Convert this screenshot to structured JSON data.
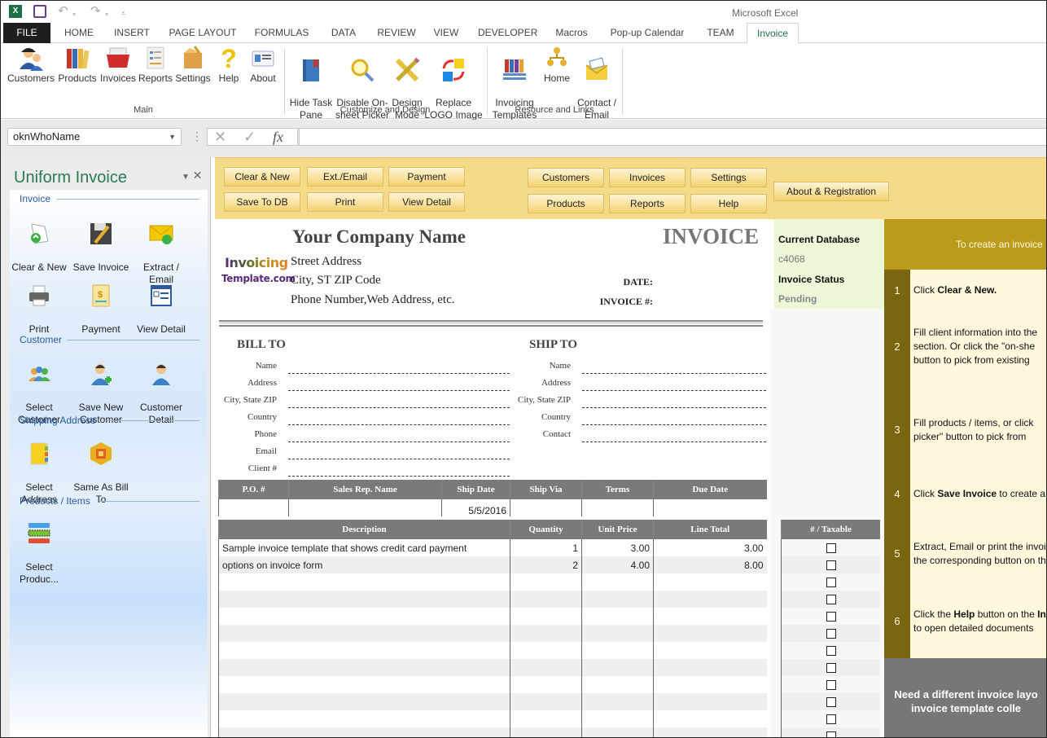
{
  "window": {
    "app_title": "Microsoft Excel",
    "quick_access": [
      "excel-logo-icon",
      "save-icon",
      "undo-icon",
      "redo-icon",
      "customize-qat-icon"
    ]
  },
  "tabs": [
    {
      "label": "FILE",
      "active": false
    },
    {
      "label": "HOME",
      "active": false
    },
    {
      "label": "INSERT",
      "active": false
    },
    {
      "label": "PAGE LAYOUT",
      "active": false
    },
    {
      "label": "FORMULAS",
      "active": false
    },
    {
      "label": "DATA",
      "active": false
    },
    {
      "label": "REVIEW",
      "active": false
    },
    {
      "label": "VIEW",
      "active": false
    },
    {
      "label": "DEVELOPER",
      "active": false
    },
    {
      "label": "Macros",
      "active": false
    },
    {
      "label": "Pop-up Calendar",
      "active": false
    },
    {
      "label": "TEAM",
      "active": false
    },
    {
      "label": "Invoice",
      "active": true
    }
  ],
  "ribbon": {
    "groups": [
      {
        "label": "Main",
        "buttons": [
          {
            "label": "Customers",
            "icon": "customers-icon"
          },
          {
            "label": "Products",
            "icon": "products-icon"
          },
          {
            "label": "Invoices",
            "icon": "invoices-icon"
          },
          {
            "label": "Reports",
            "icon": "reports-icon"
          },
          {
            "label": "Settings",
            "icon": "settings-icon"
          },
          {
            "label": "Help",
            "icon": "help-icon"
          },
          {
            "label": "About",
            "icon": "about-icon"
          }
        ]
      },
      {
        "label": "Customize and Design",
        "buttons": [
          {
            "label": "Hide Task\nPane",
            "icon": "hide-task-pane-icon"
          },
          {
            "label": "Disable On-\nsheet Picker",
            "icon": "disable-picker-icon"
          },
          {
            "label": "Design\nMode",
            "icon": "design-mode-icon"
          },
          {
            "label": "Replace\nLOGO Image",
            "icon": "replace-logo-icon"
          }
        ]
      },
      {
        "label": "Resource and Links",
        "buttons": [
          {
            "label": "Invoicing\nTemplates",
            "icon": "invoicing-templates-icon"
          },
          {
            "label": "Home",
            "icon": "home-icon"
          },
          {
            "label": "Contact /\nEmail",
            "icon": "contact-email-icon"
          }
        ]
      }
    ]
  },
  "formula_bar": {
    "name_box": "oknWhoName",
    "formula": ""
  },
  "task_pane": {
    "title": "Uniform Invoice",
    "sections": [
      {
        "title": "Invoice",
        "buttons": [
          {
            "label": "Clear & New",
            "icon": "clear-new-icon"
          },
          {
            "label": "Save Invoice",
            "icon": "save-invoice-icon"
          },
          {
            "label": "Extract /\nEmail",
            "icon": "extract-email-icon"
          },
          {
            "label": "Print",
            "icon": "print-icon"
          },
          {
            "label": "Payment",
            "icon": "payment-icon"
          },
          {
            "label": "View Detail",
            "icon": "view-detail-icon"
          }
        ]
      },
      {
        "title": "Customer",
        "buttons": [
          {
            "label": "Select\nCustomer",
            "icon": "select-customer-icon"
          },
          {
            "label": "Save New\nCustomer",
            "icon": "save-new-customer-icon"
          },
          {
            "label": "Customer\nDetail",
            "icon": "customer-detail-icon"
          }
        ]
      },
      {
        "title": "Shipping Address",
        "buttons": [
          {
            "label": "Select\nAddress",
            "icon": "select-address-icon"
          },
          {
            "label": "Same As Bill\nTo",
            "icon": "same-as-bill-to-icon"
          }
        ]
      },
      {
        "title": "Products / Items",
        "buttons": [
          {
            "label": "Select\nProduc...",
            "icon": "select-products-icon"
          }
        ]
      }
    ]
  },
  "sheet_buttons": {
    "left": [
      [
        "Clear & New",
        "Ext./Email",
        "Payment"
      ],
      [
        "Save To DB",
        "Print",
        "View Detail"
      ]
    ],
    "right": [
      [
        "Customers",
        "Invoices",
        "Settings"
      ],
      [
        "Products",
        "Reports",
        "Help"
      ]
    ],
    "about": "About & Registration"
  },
  "invoice": {
    "company_name": "Your Company Name",
    "title": "INVOICE",
    "logo_line1": "Invoicing",
    "logo_line2": "Template.com",
    "address": [
      "Street Address",
      "City, ST  ZIP Code",
      "Phone Number,Web Address, etc."
    ],
    "date_label": "DATE:",
    "date_value": "",
    "invoice_no_label": "INVOICE #:",
    "invoice_no_value": "",
    "bill_to": {
      "title": "BILL TO",
      "fields": [
        {
          "label": "Name",
          "value": ""
        },
        {
          "label": "Address",
          "value": ""
        },
        {
          "label": "City, State ZIP",
          "value": ""
        },
        {
          "label": "Country",
          "value": ""
        },
        {
          "label": "Phone",
          "value": ""
        },
        {
          "label": "Email",
          "value": ""
        },
        {
          "label": "Client #",
          "value": ""
        }
      ]
    },
    "ship_to": {
      "title": "SHIP TO",
      "fields": [
        {
          "label": "Name",
          "value": ""
        },
        {
          "label": "Address",
          "value": ""
        },
        {
          "label": "City, State ZIP",
          "value": ""
        },
        {
          "label": "Country",
          "value": ""
        },
        {
          "label": "Contact",
          "value": ""
        }
      ]
    },
    "order_info": {
      "headers": [
        "P.O. #",
        "Sales Rep. Name",
        "Ship Date",
        "Ship Via",
        "Terms",
        "Due Date"
      ],
      "values": [
        "",
        "",
        "5/5/2016",
        "",
        "",
        ""
      ]
    },
    "items": {
      "headers": [
        "Description",
        "Quantity",
        "Unit Price",
        "Line Total"
      ],
      "rows": [
        [
          "Sample invoice template that shows credit card payment",
          "1",
          "3.00",
          "3.00"
        ],
        [
          "options on invoice form",
          "2",
          "4.00",
          "8.00"
        ],
        [
          "",
          "",
          "",
          ""
        ],
        [
          "",
          "",
          "",
          ""
        ],
        [
          "",
          "",
          "",
          ""
        ],
        [
          "",
          "",
          "",
          ""
        ],
        [
          "",
          "",
          "",
          ""
        ],
        [
          "",
          "",
          "",
          ""
        ],
        [
          "",
          "",
          "",
          ""
        ],
        [
          "",
          "",
          "",
          ""
        ],
        [
          "",
          "",
          "",
          ""
        ],
        [
          "",
          "",
          "",
          ""
        ]
      ]
    },
    "taxable_header": "# / Taxable",
    "taxable": [
      false,
      false,
      false,
      false,
      false,
      false,
      false,
      false,
      false,
      false,
      false,
      false
    ]
  },
  "db_info": {
    "db_label": "Current Database",
    "db_value": "c4068",
    "status_label": "Invoice Status",
    "status_value": "Pending"
  },
  "instructions": {
    "header": "To create an invoice",
    "steps": [
      {
        "num": "1",
        "lines": [
          "Click <b>Clear &amp; New.</b>"
        ]
      },
      {
        "num": "2",
        "lines": [
          "Fill client information into the",
          "section. Or click the \"on-she",
          "button to pick from existing"
        ]
      },
      {
        "num": "3",
        "lines": [
          "Fill products / items, or click",
          " picker\" button to pick from"
        ]
      },
      {
        "num": "4",
        "lines": [
          "Click <b>Save Invoice</b> to create a"
        ]
      },
      {
        "num": "5",
        "lines": [
          "Extract, Email or print the invoi",
          "the corresponding button on th"
        ]
      },
      {
        "num": "6",
        "lines": [
          "Click the <b>Help</b> button on the <b>In</b>",
          "to open detailed documents"
        ]
      }
    ],
    "footer": [
      "Need a different invoice layo",
      "invoice template colle"
    ]
  },
  "colors": {
    "accent_green": "#217346",
    "toolbar_band": "#f5db88",
    "instr_header": "#bc9a1c",
    "instr_numcol": "#7a6510",
    "table_header": "#7a7a7a"
  }
}
